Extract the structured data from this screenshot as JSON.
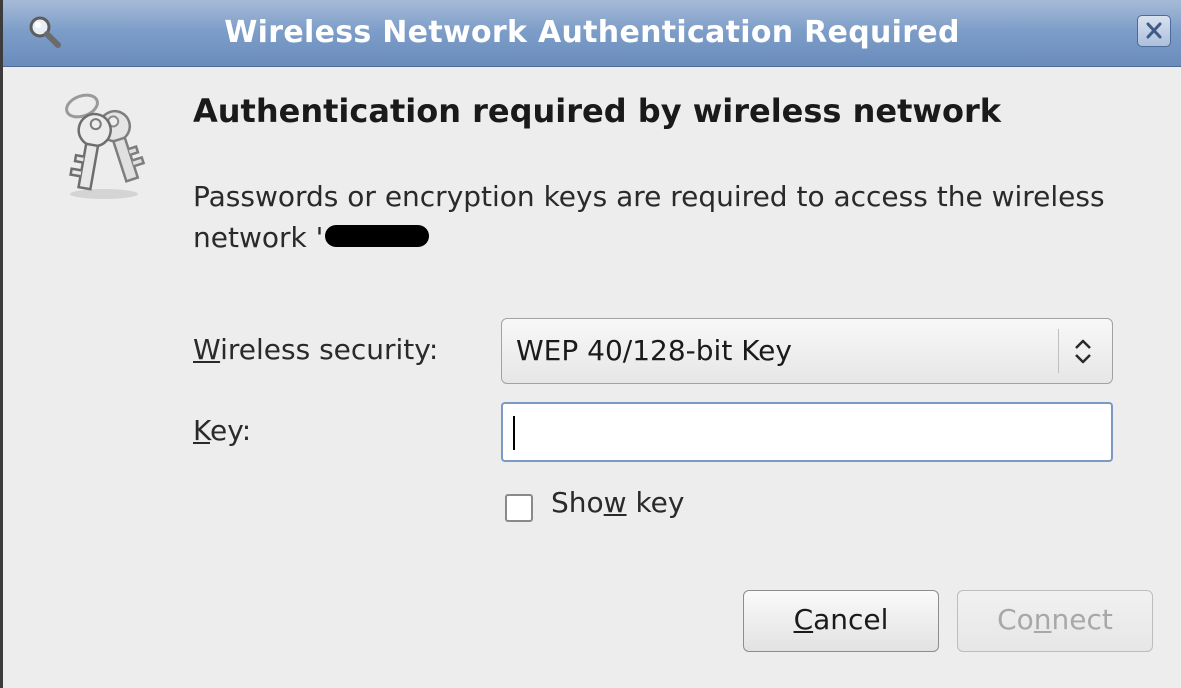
{
  "window": {
    "title": "Wireless Network Authentication Required",
    "close_label": "×"
  },
  "dialog": {
    "heading": "Authentication required by wireless network",
    "message": "Passwords or encryption keys are required to access the wireless network '",
    "network_name_redacted": true
  },
  "form": {
    "security_label_mnemonic": "W",
    "security_label_rest": "ireless security:",
    "security_value": "WEP 40/128-bit Key",
    "key_label_mnemonic": "K",
    "key_label_rest": "ey:",
    "key_value": "",
    "show_key_prefix": "Sho",
    "show_key_mnemonic": "w",
    "show_key_suffix": " key",
    "show_key_checked": false
  },
  "buttons": {
    "cancel_mnemonic": "C",
    "cancel_rest": "ancel",
    "connect_prefix": "Co",
    "connect_mnemonic": "n",
    "connect_suffix": "nect",
    "connect_enabled": false
  },
  "icons": {
    "title": "search-magnifier-icon",
    "dialog": "keys-icon",
    "combo": "updown-arrows-icon"
  },
  "colors": {
    "titlebar": "#7e9ec9",
    "background": "#ededed",
    "input_focus_border": "#7a9ac4",
    "disabled_text": "#a8a8a8"
  }
}
